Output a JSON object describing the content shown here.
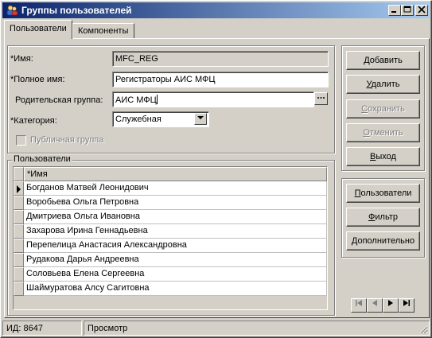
{
  "window": {
    "title": "Группы пользователей"
  },
  "tabs": [
    {
      "label": "Пользователи",
      "active": true
    },
    {
      "label": "Компоненты",
      "active": false
    }
  ],
  "form": {
    "name_label": "*Имя:",
    "name_value": "MFC_REG",
    "fullname_label": "*Полное имя:",
    "fullname_value": "Регистраторы АИС МФЦ",
    "parent_label": "Родительская группа:",
    "parent_value": "АИС МФЦ",
    "category_label": "*Категория:",
    "category_value": "Служебная",
    "public_label": "Публичная группа",
    "public_checked": false
  },
  "users": {
    "group_title": "Пользователи",
    "column_header": "*Имя",
    "rows": [
      "Богданов Матвей Леонидович",
      "Воробьева Ольга Петровна",
      "Дмитриева Ольга Ивановна",
      "Захарова Ирина Геннадьевна",
      "Перепелица Анастасия Александровна",
      "Рудакова Дарья Андреевна",
      "Соловьева Елена Сергеевна",
      "Шаймуратова Алсу Сагитовна"
    ]
  },
  "buttons": {
    "add": {
      "u": "Д",
      "rest": "обавить"
    },
    "delete": {
      "u": "У",
      "rest": "далить"
    },
    "save": {
      "u": "С",
      "rest": "охранить"
    },
    "cancel": {
      "u": "О",
      "rest": "тменить"
    },
    "exit": {
      "u": "В",
      "rest": "ыход"
    },
    "users": {
      "u": "П",
      "rest": "ользователи"
    },
    "filter": {
      "u": "Ф",
      "rest": "ильтр"
    },
    "more": {
      "u": "Д",
      "rest": "ополнительно"
    }
  },
  "status": {
    "id_text": "ИД: 8647",
    "mode_text": "Просмотр"
  },
  "icons": {
    "app": "users-app-icon",
    "minimize": "minimize-icon",
    "maximize": "maximize-icon",
    "close": "close-icon",
    "browse": "ellipsis-icon",
    "dropdown": "chevron-down-icon",
    "nav_first": "nav-first-icon",
    "nav_prev": "nav-prev-icon",
    "nav_next": "nav-next-icon",
    "nav_last": "nav-last-icon"
  }
}
